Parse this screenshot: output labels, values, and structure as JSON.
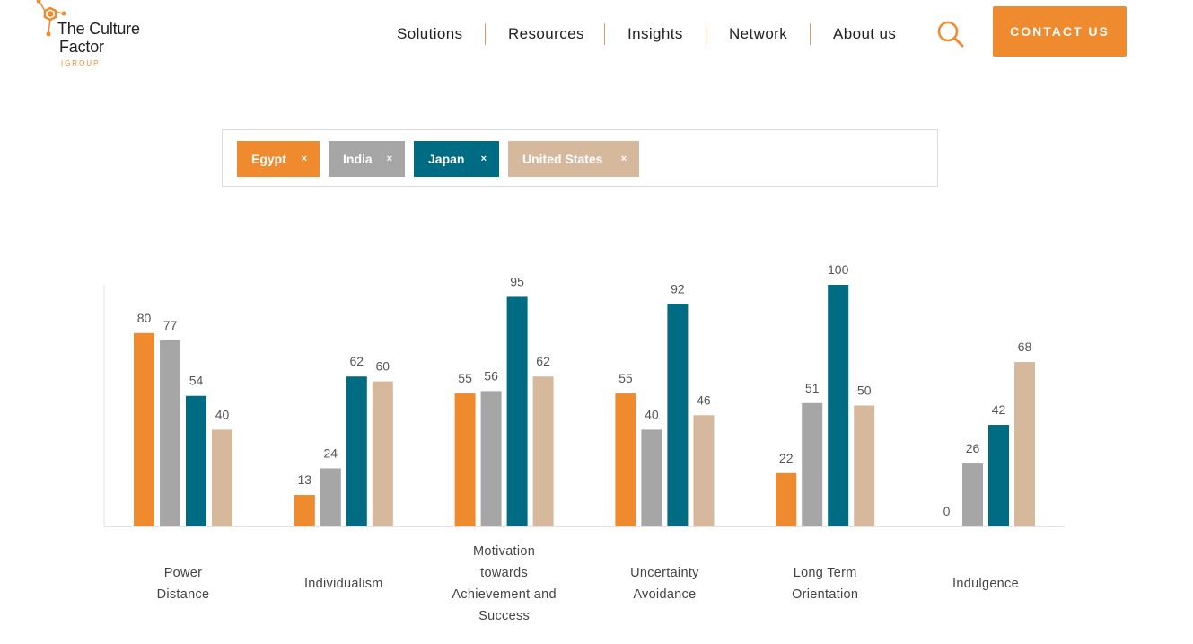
{
  "header": {
    "logo": {
      "line1": "The Culture",
      "line2": "Factor",
      "sub": "|GROUP"
    },
    "nav": [
      {
        "label": "Solutions"
      },
      {
        "label": "Resources"
      },
      {
        "label": "Insights"
      },
      {
        "label": "Network"
      },
      {
        "label": "About us"
      }
    ],
    "search_icon": "search-icon",
    "contact_label": "CONTACT US"
  },
  "filters": [
    {
      "label": "Egypt",
      "remove": "×",
      "color": "#f08a2e"
    },
    {
      "label": "India",
      "remove": "×",
      "color": "#a6a6a6"
    },
    {
      "label": "Japan",
      "remove": "×",
      "color": "#006c84"
    },
    {
      "label": "United States",
      "remove": "×",
      "color": "#d6b99d"
    }
  ],
  "chart_data": {
    "type": "bar",
    "categories": [
      "Power Distance",
      "Individualism",
      "Motivation towards Achievement and Success",
      "Uncertainty Avoidance",
      "Long Term Orientation",
      "Indulgence"
    ],
    "category_lines": [
      [
        "Power",
        "Distance"
      ],
      [
        "Individualism"
      ],
      [
        "Motivation",
        "towards",
        "Achievement and",
        "Success"
      ],
      [
        "Uncertainty",
        "Avoidance"
      ],
      [
        "Long Term",
        "Orientation"
      ],
      [
        "Indulgence"
      ]
    ],
    "series": [
      {
        "name": "Egypt",
        "color": "#f08a2e",
        "values": [
          80,
          13,
          55,
          55,
          22,
          0
        ]
      },
      {
        "name": "India",
        "color": "#a6a6a6",
        "values": [
          77,
          24,
          56,
          40,
          51,
          26
        ]
      },
      {
        "name": "Japan",
        "color": "#006c84",
        "values": [
          54,
          62,
          95,
          92,
          100,
          42
        ]
      },
      {
        "name": "United States",
        "color": "#d6b99d",
        "values": [
          40,
          60,
          62,
          46,
          50,
          68
        ]
      }
    ],
    "ylim": [
      0,
      100
    ],
    "grid": false,
    "legend": "top (filter chips)"
  }
}
